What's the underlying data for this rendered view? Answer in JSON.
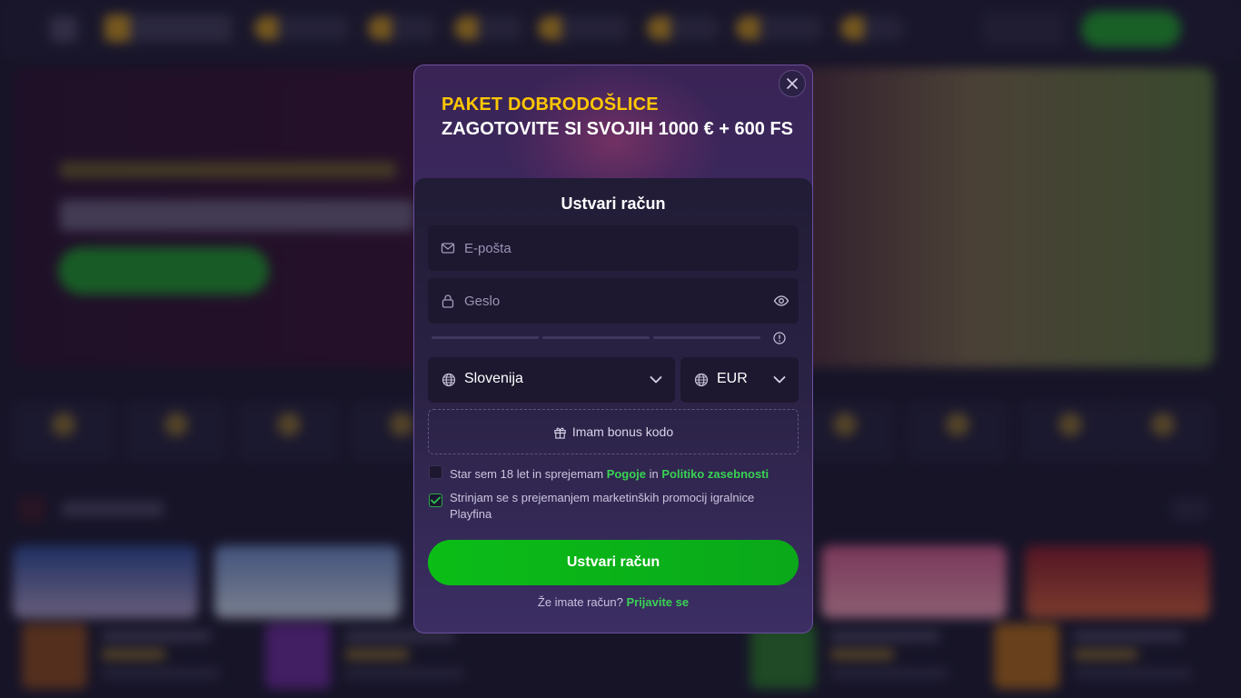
{
  "modal": {
    "promo_title": "PAKET DOBRODOŠLICE",
    "promo_subtitle": "ZAGOTOVITE SI SVOJIH 1000 € + 600 FS",
    "form_title": "Ustvari račun",
    "email": {
      "placeholder": "E-pošta",
      "value": ""
    },
    "password": {
      "placeholder": "Geslo",
      "value": ""
    },
    "country": {
      "selected": "Slovenija"
    },
    "currency": {
      "selected": "EUR"
    },
    "bonus_code_label": "Imam bonus kodo",
    "age_terms": {
      "checked": false,
      "text_before": "Star sem 18 let in sprejemam ",
      "terms_link": "Pogoje",
      "text_middle": " in ",
      "privacy_link": "Politiko zasebnosti"
    },
    "marketing": {
      "checked": true,
      "text": "Strinjam se s prejemanjem marketinških promocij igralnice Playfina"
    },
    "submit_label": "Ustvari račun",
    "login_prompt": "Že imate račun?",
    "login_link": "Prijavite se"
  },
  "colors": {
    "accent_green": "#0bbd17",
    "promo_yellow": "#ffc700",
    "link_green": "#39d353"
  }
}
